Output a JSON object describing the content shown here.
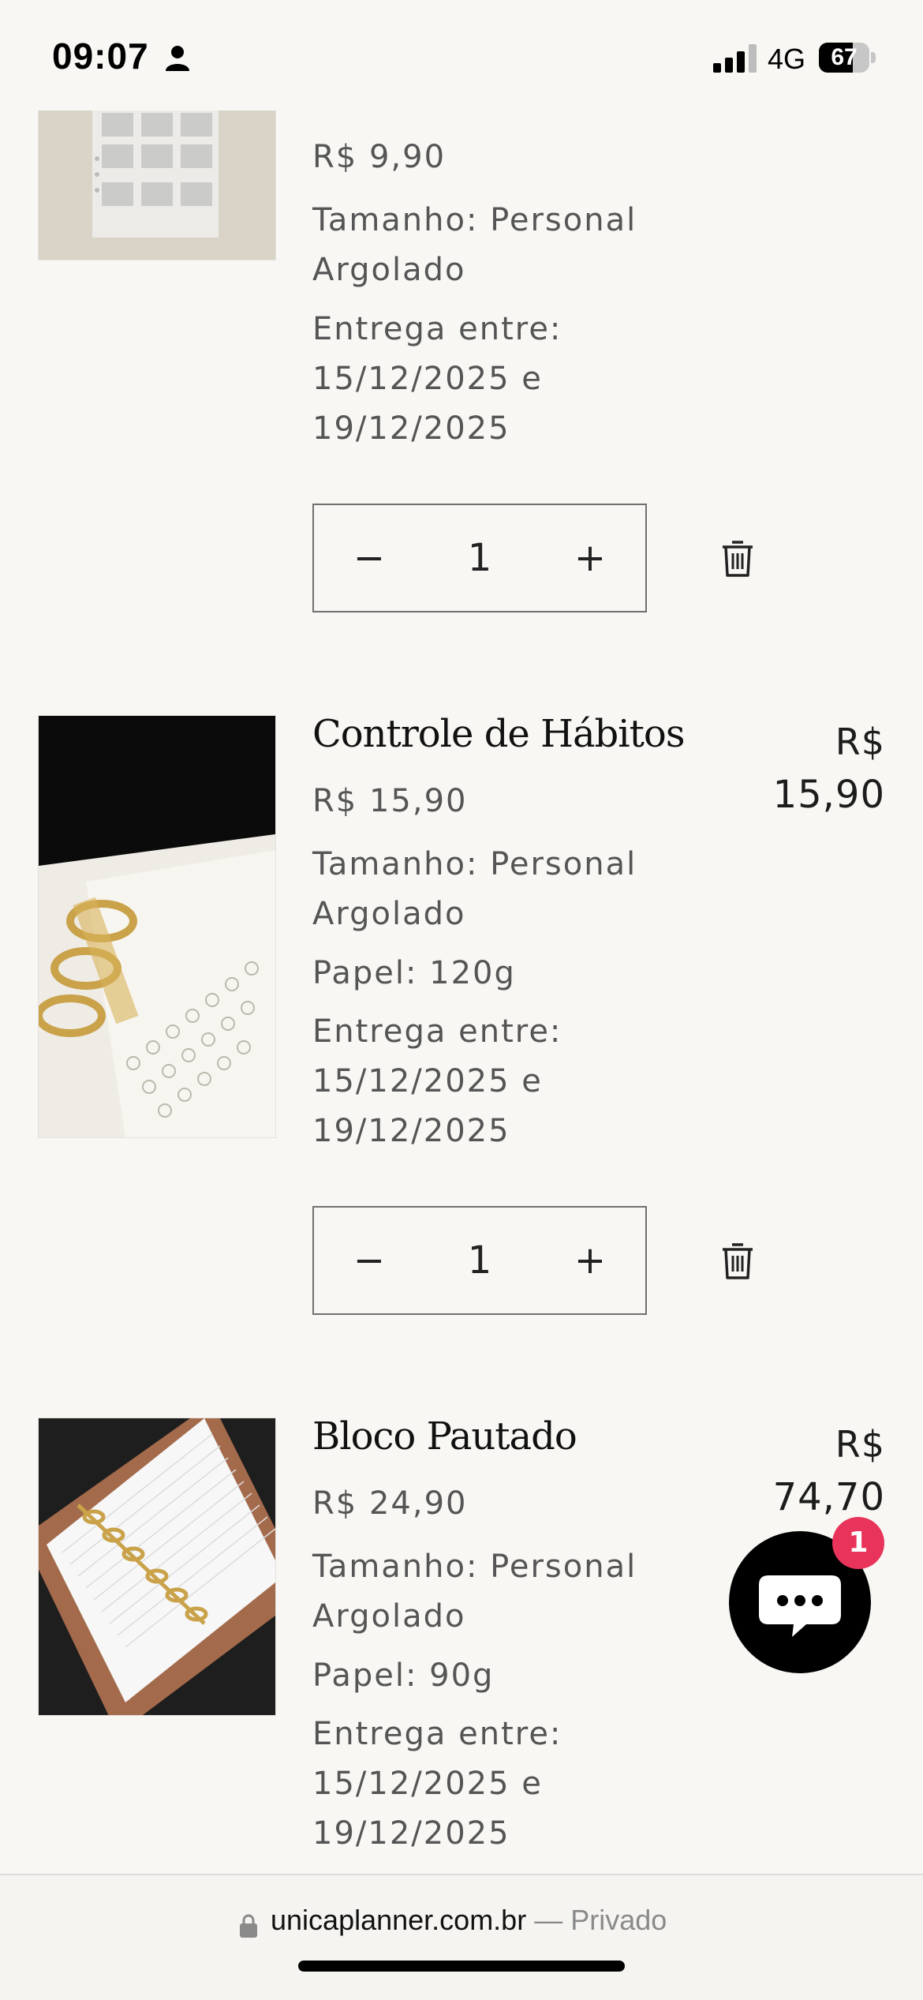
{
  "status_bar": {
    "time": "09:07",
    "network": "4G",
    "battery": "67",
    "battery_level": 0.67
  },
  "cart_items": [
    {
      "price": "R$ 9,90",
      "size_line_1": "Tamanho: Personal",
      "size_line_2": "Argolado",
      "delivery_label": "Entrega entre:",
      "delivery_from": "15/12/2025 e",
      "delivery_to": "19/12/2025",
      "quantity": "1"
    },
    {
      "title": "Controle de Hábitos",
      "price": "R$ 15,90",
      "size_line_1": "Tamanho: Personal",
      "size_line_2": "Argolado",
      "paper": "Papel: 120g",
      "delivery_label": "Entrega entre:",
      "delivery_from": "15/12/2025 e",
      "delivery_to": "19/12/2025",
      "total_currency": "R$",
      "total_value": "15,90",
      "quantity": "1"
    },
    {
      "title": "Bloco Pautado",
      "price": "R$ 24,90",
      "size_line_1": "Tamanho: Personal",
      "size_line_2": "Argolado",
      "paper": "Papel: 90g",
      "delivery_label": "Entrega entre:",
      "delivery_from": "15/12/2025 e",
      "delivery_to": "19/12/2025",
      "total_currency": "R$",
      "total_value": "74,70"
    }
  ],
  "qty_controls": {
    "minus": "−",
    "plus": "+"
  },
  "chat": {
    "badge_count": "1",
    "accent_color": "#e8335a"
  },
  "browser_bar": {
    "domain": "unicaplanner.com.br",
    "mode": " — Privado"
  },
  "colors": {
    "background": "#f8f7f4",
    "text": "#222222",
    "muted": "#555555"
  }
}
